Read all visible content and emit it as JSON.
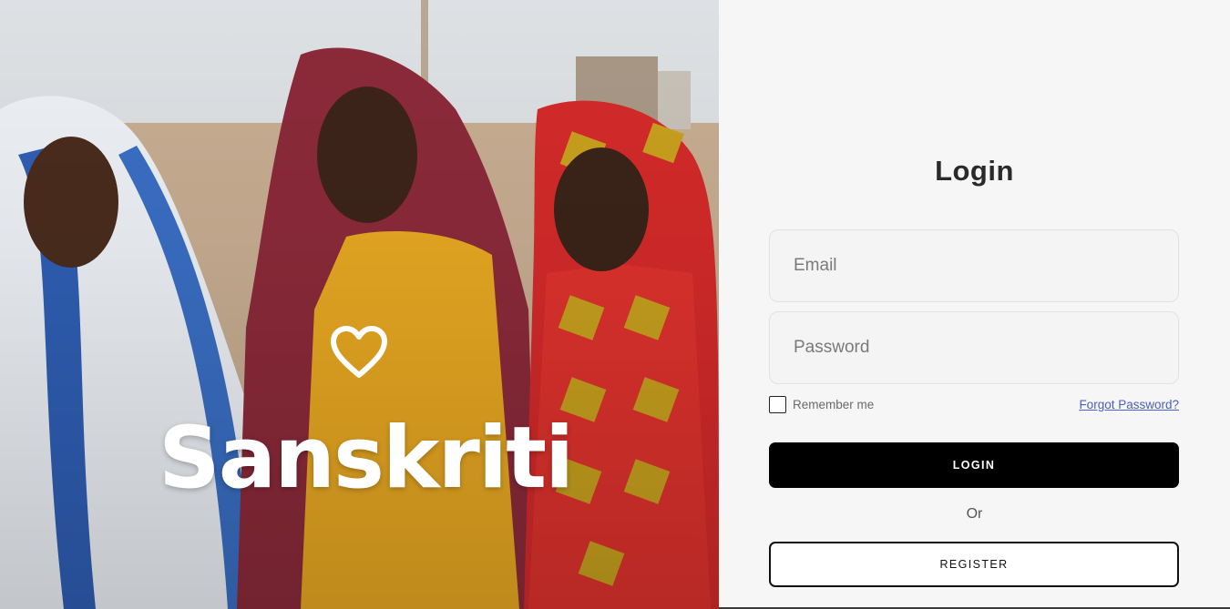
{
  "brand": {
    "name": "Sanskriti",
    "logo_icon": "heart-outline-icon"
  },
  "hero": {
    "image": "photo-three-women-in-colorful-headscarves"
  },
  "form": {
    "title": "Login",
    "email_placeholder": "Email",
    "password_placeholder": "Password",
    "remember_label": "Remember me",
    "remember_checked": false,
    "forgot_label": "Forgot Password?",
    "login_label": "LOGIN",
    "or_text": "Or",
    "register_label": "REGISTER"
  },
  "colors": {
    "panel_bg": "#f6f6f6",
    "primary_button": "#000000",
    "link": "#4a5fc1"
  }
}
